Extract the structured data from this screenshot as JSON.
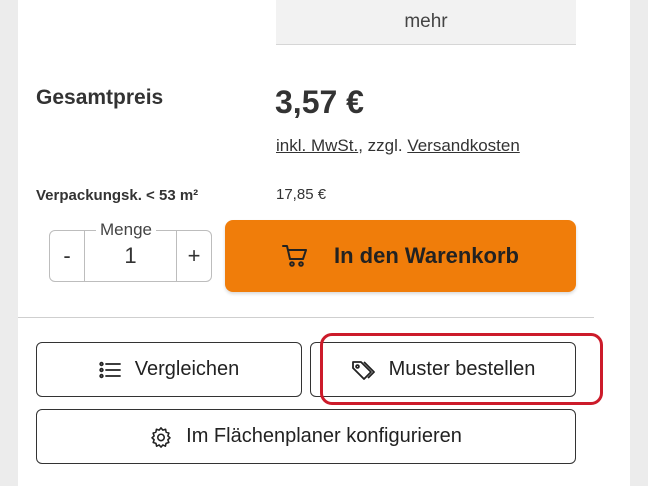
{
  "more_label": "mehr",
  "price_section": {
    "total_label": "Gesamtpreis",
    "price": "3,57 €",
    "vat_link": "inkl. MwSt.",
    "shipping_prefix": ", zzgl. ",
    "shipping_link": "Versandkosten"
  },
  "package": {
    "label": "Verpackungsk. < 53 m²",
    "price": "17,85 €"
  },
  "quantity": {
    "legend": "Menge",
    "minus": "-",
    "value": "1",
    "plus": "+"
  },
  "cart_button": {
    "label": "In den Warenkorb",
    "icon": "shopping-cart-icon",
    "color": "#f07d0a"
  },
  "actions": {
    "compare": {
      "label": "Vergleichen",
      "icon": "list-icon"
    },
    "sample": {
      "label": "Muster bestellen",
      "icon": "tag-icon"
    },
    "planner": {
      "label": "Im Flächenplaner konfigurieren",
      "icon": "gear-icon"
    }
  },
  "highlight_color": "#cc1b2a"
}
